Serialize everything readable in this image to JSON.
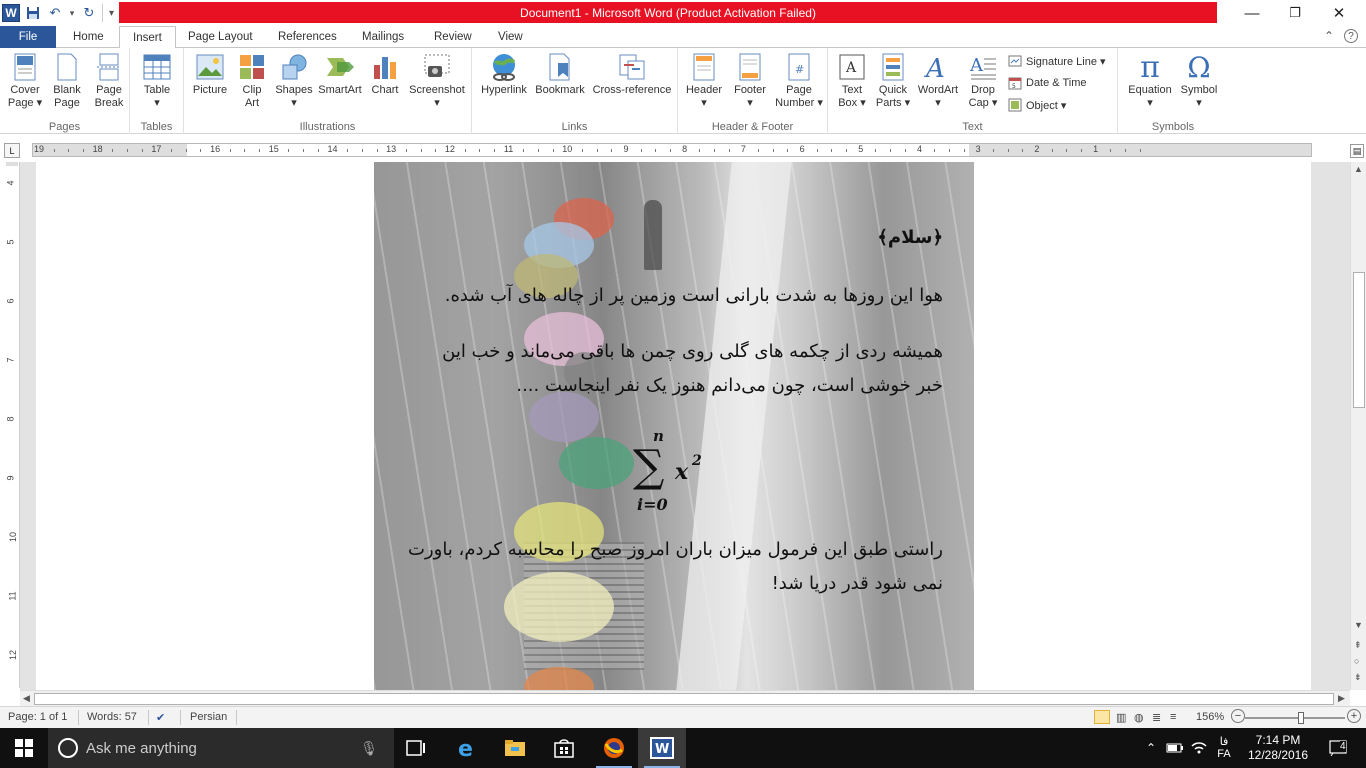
{
  "window": {
    "title": "Document1  -  Microsoft Word (Product Activation Failed)",
    "min_glyph": "—",
    "max_glyph": "❐",
    "close_glyph": "✕"
  },
  "qat": {
    "save_glyph": "💾",
    "undo_glyph": "↶",
    "redo_glyph": "↻",
    "customize_glyph": "▾"
  },
  "tabs": [
    "File",
    "Home",
    "Insert",
    "Page Layout",
    "References",
    "Mailings",
    "Review",
    "View"
  ],
  "active_tab": "Insert",
  "ribbon": {
    "groups": {
      "pages": "Pages",
      "tables": "Tables",
      "illustrations": "Illustrations",
      "links": "Links",
      "header_footer": "Header & Footer",
      "text": "Text",
      "symbols": "Symbols"
    },
    "buttons": {
      "cover_page": "Cover\nPage ▾",
      "blank_page": "Blank\nPage",
      "page_break": "Page\nBreak",
      "table": "Table\n▾",
      "picture": "Picture",
      "clip_art": "Clip\nArt",
      "shapes": "Shapes\n▾",
      "smartart": "SmartArt",
      "chart": "Chart",
      "screenshot": "Screenshot\n▾",
      "hyperlink": "Hyperlink",
      "bookmark": "Bookmark",
      "cross_reference": "Cross-reference",
      "header": "Header\n▾",
      "footer": "Footer\n▾",
      "page_number": "Page\nNumber ▾",
      "text_box": "Text\nBox ▾",
      "quick_parts": "Quick\nParts ▾",
      "wordart": "WordArt\n▾",
      "drop_cap": "Drop\nCap ▾",
      "signature_line": "Signature Line ▾",
      "date_time": "Date & Time",
      "object": "Object ▾",
      "equation": "Equation\n▾",
      "symbol": "Symbol\n▾"
    }
  },
  "ruler": {
    "numbers": [
      "19",
      "18",
      "17",
      "16",
      "15",
      "14",
      "13",
      "12",
      "11",
      "10",
      "9",
      "8",
      "7",
      "6",
      "5",
      "4",
      "3",
      "2",
      "1"
    ],
    "vnumbers": [
      "4",
      "5",
      "6",
      "7",
      "8",
      "9",
      "10",
      "11",
      "12"
    ]
  },
  "document": {
    "lines": [
      "﴿سلام﴾",
      "هوا این روزها به شدت بارانی است وزمین پر از چاله های آب شده.",
      "همیشه ردی از چکمه های گلی روی چمن ها باقی می‌ماند و خب این",
      "خبر خوشی است، چون می‌دانم هنوز یک نفر اینجاست ....",
      "راستی طبق این فرمول میزان باران امروز صبح را محاسبه کردم، باورت",
      "نمی شود قدر دریا شد!"
    ],
    "formula": {
      "sigma": "∑",
      "upper": "n",
      "lower": "i=0",
      "term": "x",
      "power": "2"
    }
  },
  "statusbar": {
    "page": "Page: 1 of 1",
    "words": "Words: 57",
    "language": "Persian",
    "zoom": "156%",
    "zoom_minus": "−",
    "zoom_plus": "+"
  },
  "taskbar": {
    "search_placeholder": "Ask me anything",
    "time": "7:14 PM",
    "date": "12/28/2016",
    "lang_top": "فا",
    "lang_bottom": "FA",
    "notifications": "4"
  }
}
